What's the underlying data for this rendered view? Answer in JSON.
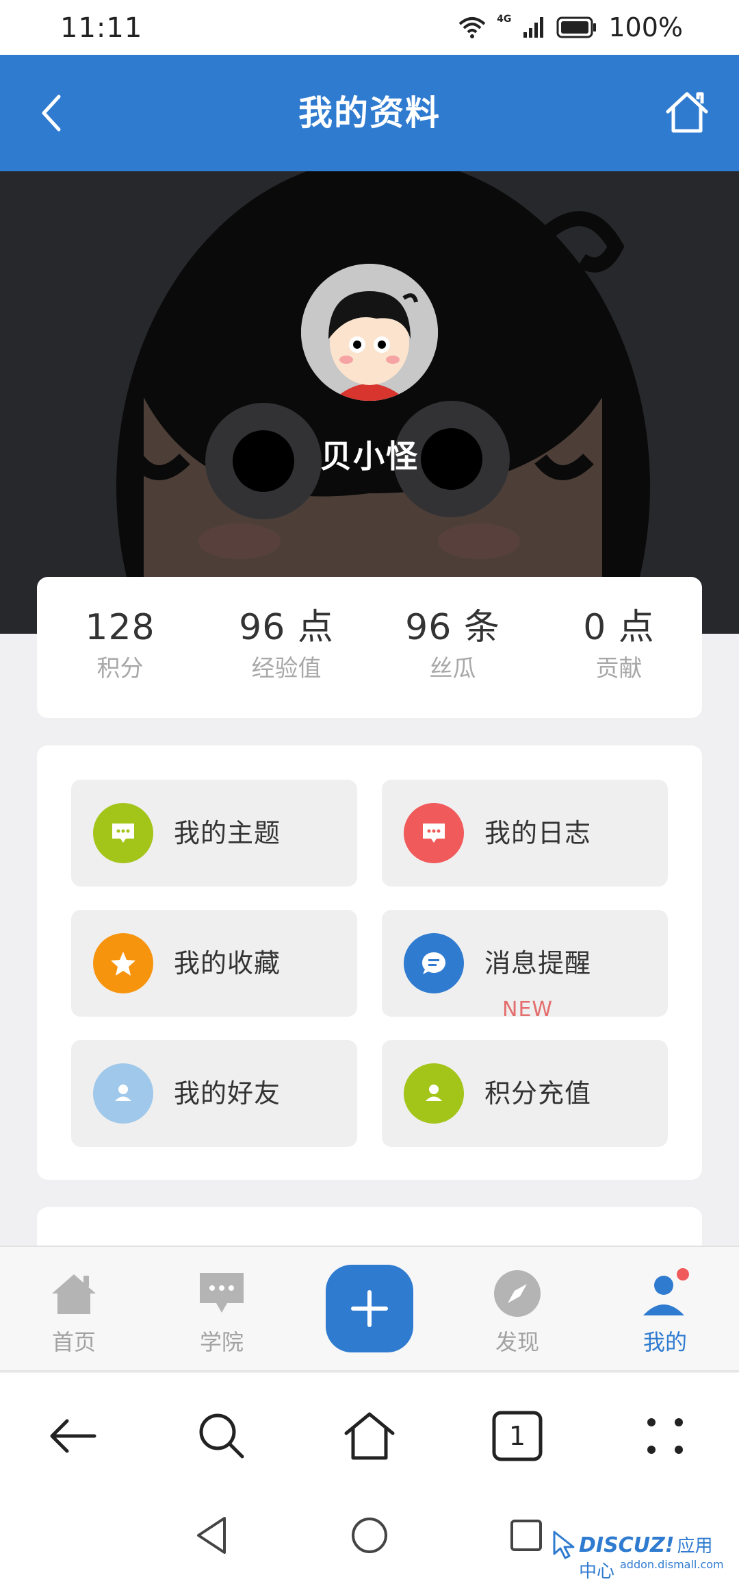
{
  "status_bar": {
    "time": "11:11",
    "network": "4G",
    "battery": "100%"
  },
  "header": {
    "title": "我的资料",
    "back_icon": "chevron-left-icon",
    "home_icon": "home-icon"
  },
  "profile": {
    "name": "贝小怪"
  },
  "stats": [
    {
      "value": "128",
      "label": "积分"
    },
    {
      "value": "96 点",
      "label": "经验值"
    },
    {
      "value": "96 条",
      "label": "丝瓜"
    },
    {
      "value": "0 点",
      "label": "贡献"
    }
  ],
  "menu": [
    {
      "label": "我的主题",
      "icon": "chat-icon",
      "color": "#a3c418"
    },
    {
      "label": "我的日志",
      "icon": "chat-icon",
      "color": "#f05a5a"
    },
    {
      "label": "我的收藏",
      "icon": "star-icon",
      "color": "#f7940d"
    },
    {
      "label": "消息提醒",
      "icon": "message-icon",
      "color": "#2f7bd0",
      "badge": "NEW"
    },
    {
      "label": "我的好友",
      "icon": "user-icon",
      "color": "#a0c8ea"
    },
    {
      "label": "积分充值",
      "icon": "user-icon",
      "color": "#a3c418"
    }
  ],
  "tabs": [
    {
      "label": "首页",
      "icon": "house-icon"
    },
    {
      "label": "学院",
      "icon": "chat-bubble-icon"
    },
    {
      "label": "发现",
      "icon": "compass-icon"
    },
    {
      "label": "我的",
      "icon": "person-icon",
      "active": true
    }
  ],
  "browser": {
    "tab_count": "1"
  },
  "watermark": {
    "brand": "DISCUZ!",
    "text": "应用中心",
    "url": "addon.dismall.com"
  },
  "colors": {
    "primary": "#2f7bd0",
    "hero_bg": "#2e2f33",
    "page_bg": "#f0f0f2"
  }
}
